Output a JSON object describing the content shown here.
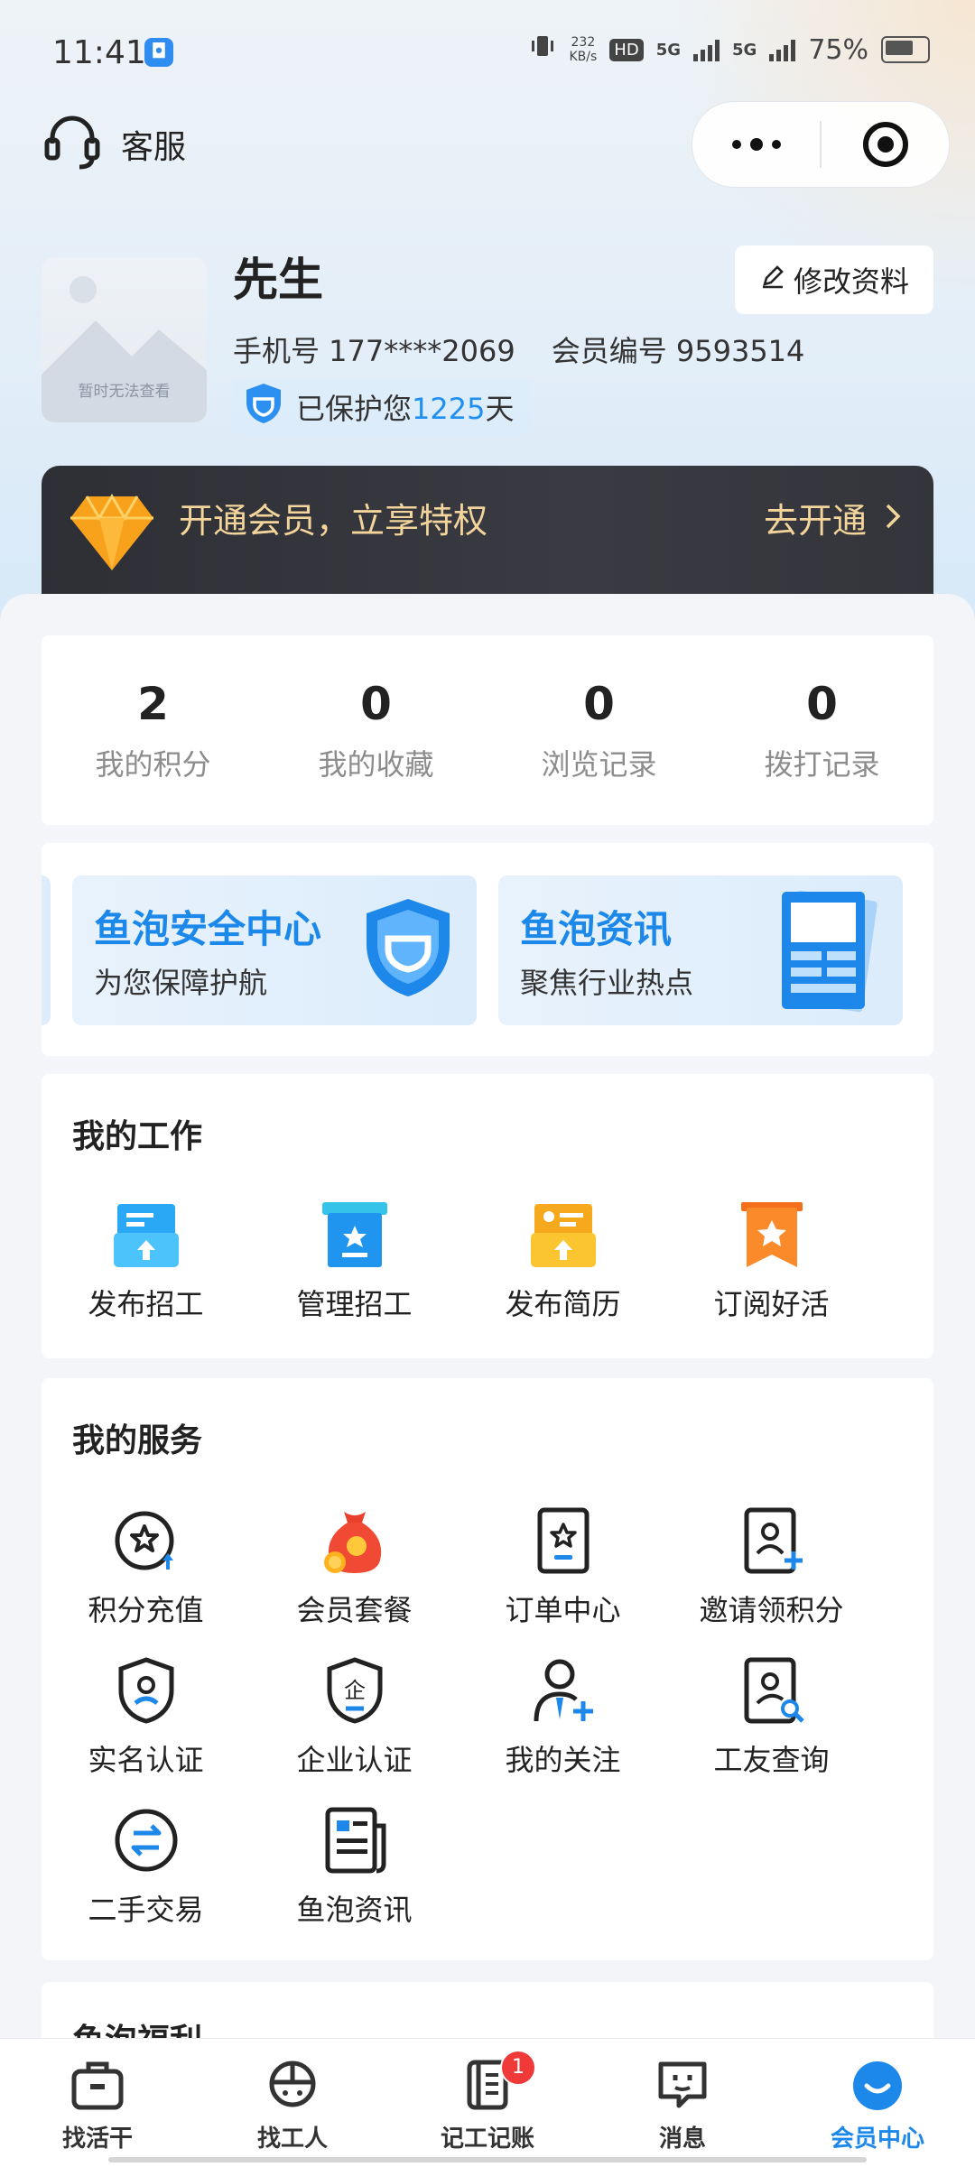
{
  "status": {
    "time": "11:41",
    "speed_top": "232",
    "speed_unit": "KB/s",
    "hd": "HD",
    "net1": "5G",
    "net2": "5G",
    "battery": "75%"
  },
  "header": {
    "service_label": "客服"
  },
  "profile": {
    "name": "先生",
    "avatar_note": "暂时无法查看",
    "edit_label": "修改资料",
    "phone": "手机号 177****2069",
    "member_id": "会员编号 9593514",
    "protect_prefix": "已保护您",
    "protect_days": "1225",
    "protect_suffix": "天"
  },
  "vip": {
    "text": "开通会员，立享特权",
    "action": "去开通"
  },
  "stats": [
    {
      "value": "2",
      "label": "我的积分"
    },
    {
      "value": "0",
      "label": "我的收藏"
    },
    {
      "value": "0",
      "label": "浏览记录"
    },
    {
      "value": "0",
      "label": "拨打记录"
    }
  ],
  "banners": [
    {
      "title": "鱼泡安全中心",
      "subtitle": "为您保障护航"
    },
    {
      "title": "鱼泡资讯",
      "subtitle": "聚焦行业热点"
    }
  ],
  "work": {
    "title": "我的工作",
    "items": [
      "发布招工",
      "管理招工",
      "发布简历",
      "订阅好活"
    ]
  },
  "services": {
    "title": "我的服务",
    "items": [
      "积分充值",
      "会员套餐",
      "订单中心",
      "邀请领积分",
      "实名认证",
      "企业认证",
      "我的关注",
      "工友查询",
      "二手交易",
      "鱼泡资讯"
    ]
  },
  "welfare": {
    "title": "鱼泡福利"
  },
  "tabbar": {
    "items": [
      "找活干",
      "找工人",
      "记工记账",
      "消息",
      "会员中心"
    ],
    "badge": "1",
    "active_color": "#1b88ea"
  }
}
